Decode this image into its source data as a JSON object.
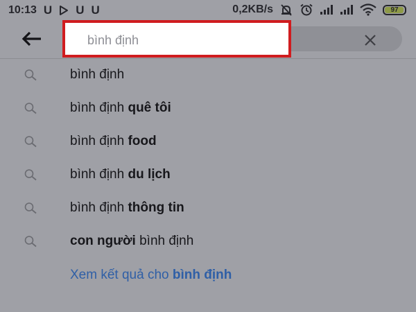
{
  "status_bar": {
    "time": "10:13",
    "app_icons": [
      "U",
      "play-icon",
      "U",
      "U"
    ],
    "network_speed": "0,2KB/s",
    "battery_level": "97",
    "battery_color": "#8e9a47"
  },
  "search": {
    "query": "bình định",
    "highlight_color": "#d01c1f"
  },
  "suggestions": [
    {
      "plain_prefix": "bình định",
      "bold": "",
      "plain_suffix": ""
    },
    {
      "plain_prefix": "bình định ",
      "bold": "quê tôi",
      "plain_suffix": ""
    },
    {
      "plain_prefix": "bình định ",
      "bold": "food",
      "plain_suffix": ""
    },
    {
      "plain_prefix": "bình định ",
      "bold": "du lịch",
      "plain_suffix": ""
    },
    {
      "plain_prefix": "bình định ",
      "bold": "thông tin",
      "plain_suffix": ""
    },
    {
      "plain_prefix": "",
      "bold": "con người",
      "plain_suffix": " bình định"
    }
  ],
  "see_results": {
    "prefix": "Xem kết quả cho ",
    "query": "bình định",
    "color": "#2f5fa6"
  }
}
